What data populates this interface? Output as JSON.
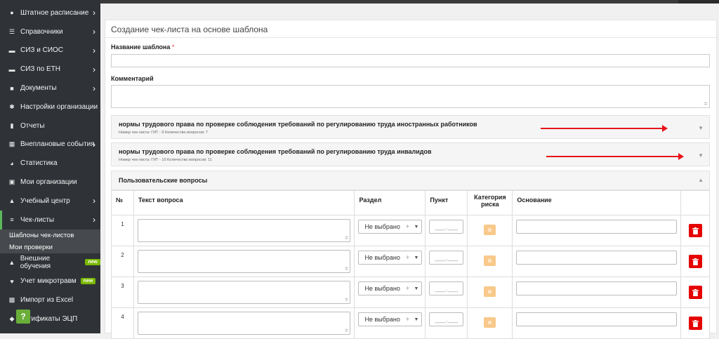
{
  "sidebar": {
    "items": [
      {
        "label": "Штатное расписание",
        "icon": "users-icon",
        "has_chevron": true
      },
      {
        "label": "Справочники",
        "icon": "list-icon",
        "has_chevron": true
      },
      {
        "label": "СИЗ и СИОС",
        "icon": "car-icon",
        "has_chevron": true
      },
      {
        "label": "СИЗ по ЕТН",
        "icon": "car-icon",
        "has_chevron": true
      },
      {
        "label": "Документы",
        "icon": "folder-icon",
        "has_chevron": true
      },
      {
        "label": "Настройки организации",
        "icon": "gear-icon",
        "has_chevron": false
      },
      {
        "label": "Отчеты",
        "icon": "clipboard-icon",
        "has_chevron": false
      },
      {
        "label": "Внеплановые события",
        "icon": "calendar-icon",
        "has_chevron": true
      },
      {
        "label": "Статистика",
        "icon": "pie-chart-icon",
        "has_chevron": false
      },
      {
        "label": "Мои организации",
        "icon": "briefcase-icon",
        "has_chevron": false
      },
      {
        "label": "Учебный центр",
        "icon": "graduation-cap-icon",
        "has_chevron": true
      },
      {
        "label": "Чек-листы",
        "icon": "checklist-icon",
        "has_chevron": true
      }
    ],
    "subitems": [
      "Шаблоны чек-листов",
      "Мои проверки"
    ],
    "items_after": [
      {
        "label": "Внешние обучения",
        "icon": "graduation-cap-icon",
        "badge": "new"
      },
      {
        "label": "Учет микротравм",
        "icon": "heartbeat-icon",
        "badge": "new"
      },
      {
        "label": "Импорт из Excel",
        "icon": "excel-file-icon",
        "badge": ""
      },
      {
        "label": "ертификаты ЭЦП",
        "icon": "certificate-icon",
        "badge": ""
      }
    ],
    "help_label": "?"
  },
  "form": {
    "title": "Создание чек-листа на основе шаблона",
    "name_label": "Название шаблона",
    "required_mark": "*",
    "comment_label": "Комментарий"
  },
  "panels": [
    {
      "title": "нормы трудового права по проверке соблюдения требований по регулированию труда иностранных работников",
      "subtitle": "Номер чек-листа: ГИТ - 9 Количество вопросов: 7"
    },
    {
      "title": "нормы трудового права по проверке соблюдения требований по регулированию труда инвалидов",
      "subtitle": "Номер чек-листа: ГИТ - 10 Количество вопросов: 11"
    }
  ],
  "custom": {
    "title": "Пользовательские вопросы",
    "columns": [
      "№",
      "Текст вопроса",
      "Раздел",
      "Пункт",
      "Категория риска",
      "Основание",
      ""
    ],
    "rows": [
      {
        "num": "1",
        "section": "Не выбрано",
        "point": "___.___"
      },
      {
        "num": "2",
        "section": "Не выбрано",
        "point": "___.___"
      },
      {
        "num": "3",
        "section": "Не выбрано",
        "point": "___.___"
      },
      {
        "num": "4",
        "section": "Не выбрано",
        "point": "___.___"
      }
    ]
  },
  "colors": {
    "sidebar_bg": "#2f3338",
    "accent_green": "#5cb85c",
    "badge_new": "#7ab800",
    "delete_red": "#e60000",
    "risk_orange": "#f8c98a",
    "annotation_arrow": "#e8141a"
  }
}
